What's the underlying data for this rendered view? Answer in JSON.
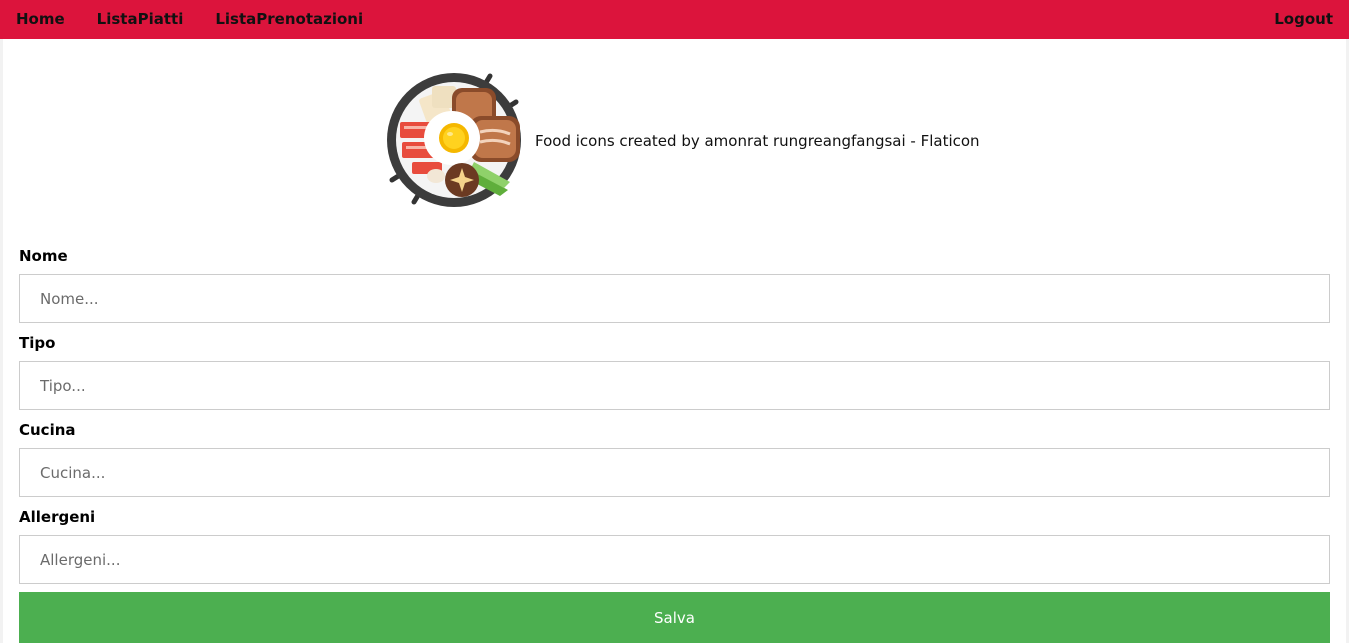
{
  "nav": {
    "links": [
      "Home",
      "ListaPiatti",
      "ListaPrenotazioni"
    ],
    "logout": "Logout"
  },
  "credit": {
    "icon": "food-bowl-icon",
    "text": "Food icons created by amonrat rungreangfangsai - Flaticon"
  },
  "form": {
    "fields": [
      {
        "label": "Nome",
        "placeholder": "Nome...",
        "value": ""
      },
      {
        "label": "Tipo",
        "placeholder": "Tipo...",
        "value": ""
      },
      {
        "label": "Cucina",
        "placeholder": "Cucina...",
        "value": ""
      },
      {
        "label": "Allergeni",
        "placeholder": "Allergeni...",
        "value": ""
      }
    ],
    "submit_label": "Salva"
  },
  "colors": {
    "navbar": "#dc143c",
    "button": "#4caf50",
    "background": "#f2f2f2"
  }
}
